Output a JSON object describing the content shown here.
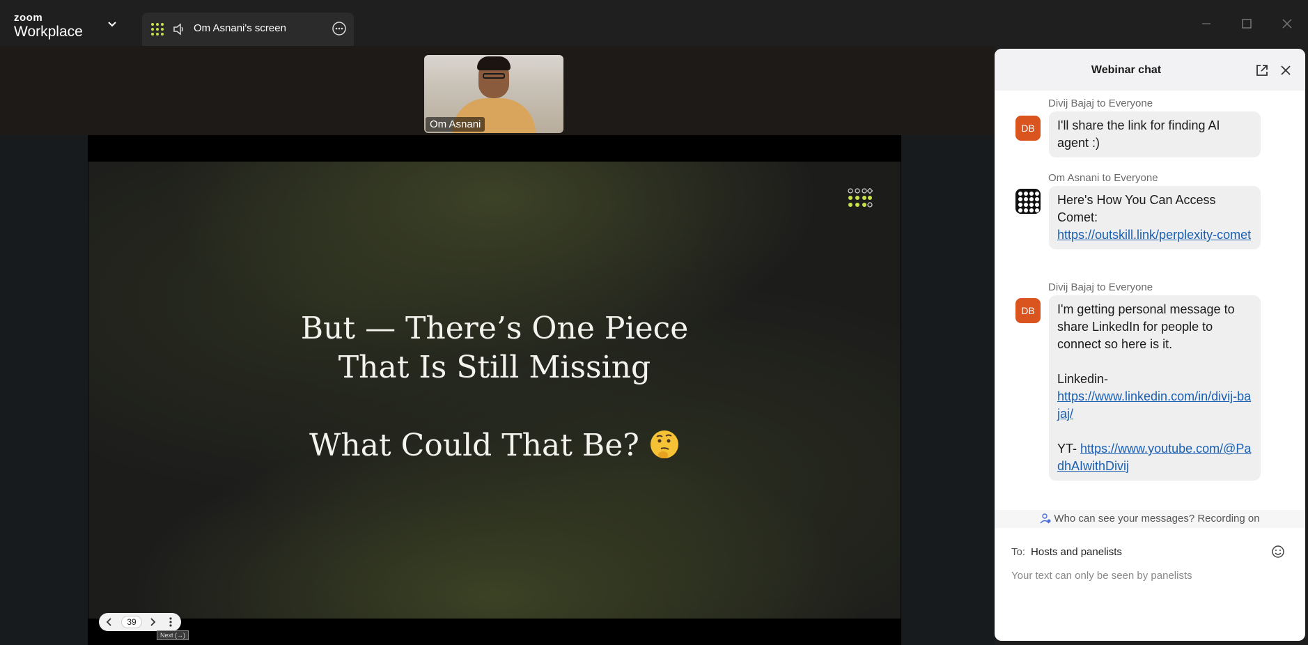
{
  "app": {
    "brand_top": "zoom",
    "brand_bottom": "Workplace"
  },
  "tab": {
    "label": "Om Asnani's screen"
  },
  "video": {
    "name": "Om Asnani"
  },
  "slide": {
    "line1": "But — There’s One Piece",
    "line2": "That Is Still Missing",
    "line3": "What Could That Be?"
  },
  "pager": {
    "page": "39",
    "tooltip": "Next (→)"
  },
  "chat": {
    "title": "Webinar chat",
    "messages": [
      {
        "sender": "Divij Bajaj to Everyone",
        "initials": "DB",
        "text": "I'll share the link for finding AI agent :)"
      },
      {
        "sender": "Om Asnani to Everyone",
        "text": "Here's How You Can Access Comet:",
        "link": "https://outskill.link/perplexity-comet"
      },
      {
        "sender": "Divij Bajaj to Everyone",
        "initials": "DB",
        "text": "I'm getting personal message to share LinkedIn for people to connect so here is it.",
        "linkedin_label": "Linkedin-",
        "linkedin_url": "https://www.linkedin.com/in/divij-bajaj/",
        "yt_label": "YT-",
        "yt_url": "https://www.youtube.com/@PadhAIwithDivij"
      }
    ],
    "privacy": "Who can see your messages? Recording on",
    "to_label": "To:",
    "to_value": "Hosts and panelists",
    "compose_placeholder": "Your text can only be seen by panelists"
  },
  "colors": {
    "accent_logo": "#c8e04a",
    "avatar_db": "#d9541e",
    "link": "#1a5fb4"
  }
}
